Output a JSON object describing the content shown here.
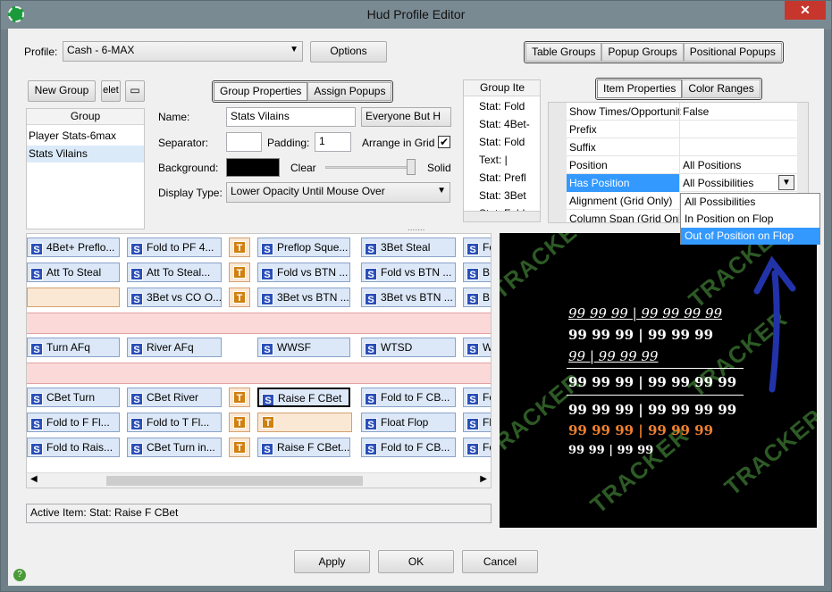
{
  "window": {
    "title": "Hud Profile Editor",
    "close_glyph": "✕"
  },
  "profile": {
    "label": "Profile:",
    "value": "Cash - 6-MAX",
    "options_label": "Options"
  },
  "top_tabs": [
    "Table Groups",
    "Popup Groups",
    "Positional Popups"
  ],
  "left": {
    "new_group": "New Group",
    "delete_partial": "elet",
    "column_header": "Group",
    "groups": [
      "Player Stats-6max",
      "Stats Vilains"
    ],
    "selected_group": 1
  },
  "group_tabs": [
    "Group Properties",
    "Assign Popups"
  ],
  "group_props": {
    "name_label": "Name:",
    "name_value": "Stats Vilains",
    "visibility_value": "Everyone But H",
    "separator_label": "Separator:",
    "padding_label": "Padding:",
    "padding_value": "1",
    "arrange_label": "Arrange in Grid",
    "arrange_checked": true,
    "background_label": "Background:",
    "clear_label": "Clear",
    "solid_label": "Solid",
    "display_type_label": "Display Type:",
    "display_type_value": "Lower Opacity Until Mouse Over"
  },
  "items_list": {
    "header": "Group Ite",
    "items": [
      "Stat: Fold",
      "Stat: 4Bet-",
      "Stat: Fold",
      "Text: |",
      "Stat: Prefl",
      "Stat: 3Bet",
      "Stat: Fold"
    ]
  },
  "item_tabs": [
    "Item Properties",
    "Color Ranges"
  ],
  "item_props": [
    {
      "k": "Show Times/Opportunities",
      "v": "False"
    },
    {
      "k": "Prefix",
      "v": ""
    },
    {
      "k": "Suffix",
      "v": ""
    },
    {
      "k": "Position",
      "v": "All Positions"
    },
    {
      "k": "Has Position",
      "v": "All Possibilities"
    },
    {
      "k": "Alignment (Grid Only)",
      "v": ""
    },
    {
      "k": "Column Span (Grid Only)",
      "v": ""
    }
  ],
  "dropdown": {
    "options": [
      "All Possibilities",
      "In Position on Flop",
      "Out of Position on Flop"
    ],
    "selected": 2
  },
  "grid": {
    "rows": [
      [
        "4Bet+ Preflo...",
        "Fold to PF 4...",
        "T",
        "Preflop Sque...",
        "3Bet Steal",
        "Fo"
      ],
      [
        "Att To Steal",
        "Att To Steal...",
        "T",
        "Fold vs BTN ...",
        "Fold vs BTN ...",
        "BB"
      ],
      [
        "",
        "3Bet vs CO O...",
        "T",
        "3Bet vs BTN ...",
        "3Bet vs BTN ...",
        "BB"
      ],
      [
        "Turn AFq",
        "River AFq",
        "",
        "WWSF",
        "WTSD",
        "W"
      ],
      [
        "CBet Turn",
        "CBet River",
        "T",
        "Raise F CBet",
        "Fold to F CB...",
        "Fo"
      ],
      [
        "Fold to F Fl...",
        "Fold to T Fl...",
        "T",
        "T",
        "Float Flop",
        "Flo"
      ],
      [
        "Fold to Rais...",
        "CBet Turn in...",
        "T",
        "Raise F CBet...",
        "Fold to F CB...",
        "Fo"
      ]
    ]
  },
  "status": {
    "active_item": "Active Item: Stat: Raise F CBet"
  },
  "hud": {
    "watermark": "TRACKER",
    "lines": [
      {
        "t": "99 99 99 | 99 99 99 99"
      },
      {
        "t": "99 99 99 | 99 99 99"
      },
      {
        "t": "99 | 99 99 99"
      },
      {
        "t": "99 99 99 | 99 99 99 99"
      },
      {
        "t": "99 99 99 | 99 99 99 99"
      },
      {
        "t": "99 99 99 | 99 99 99"
      },
      {
        "t": "99 99 | 99 99"
      }
    ],
    "colors": {
      "bg": "#000000",
      "text": "#ffffff",
      "orange": "#f08030",
      "pink": "#ff78b4",
      "watermark": "#2d5a25",
      "arrow": "#2233aa"
    }
  },
  "footer": {
    "apply": "Apply",
    "ok": "OK",
    "cancel": "Cancel"
  }
}
